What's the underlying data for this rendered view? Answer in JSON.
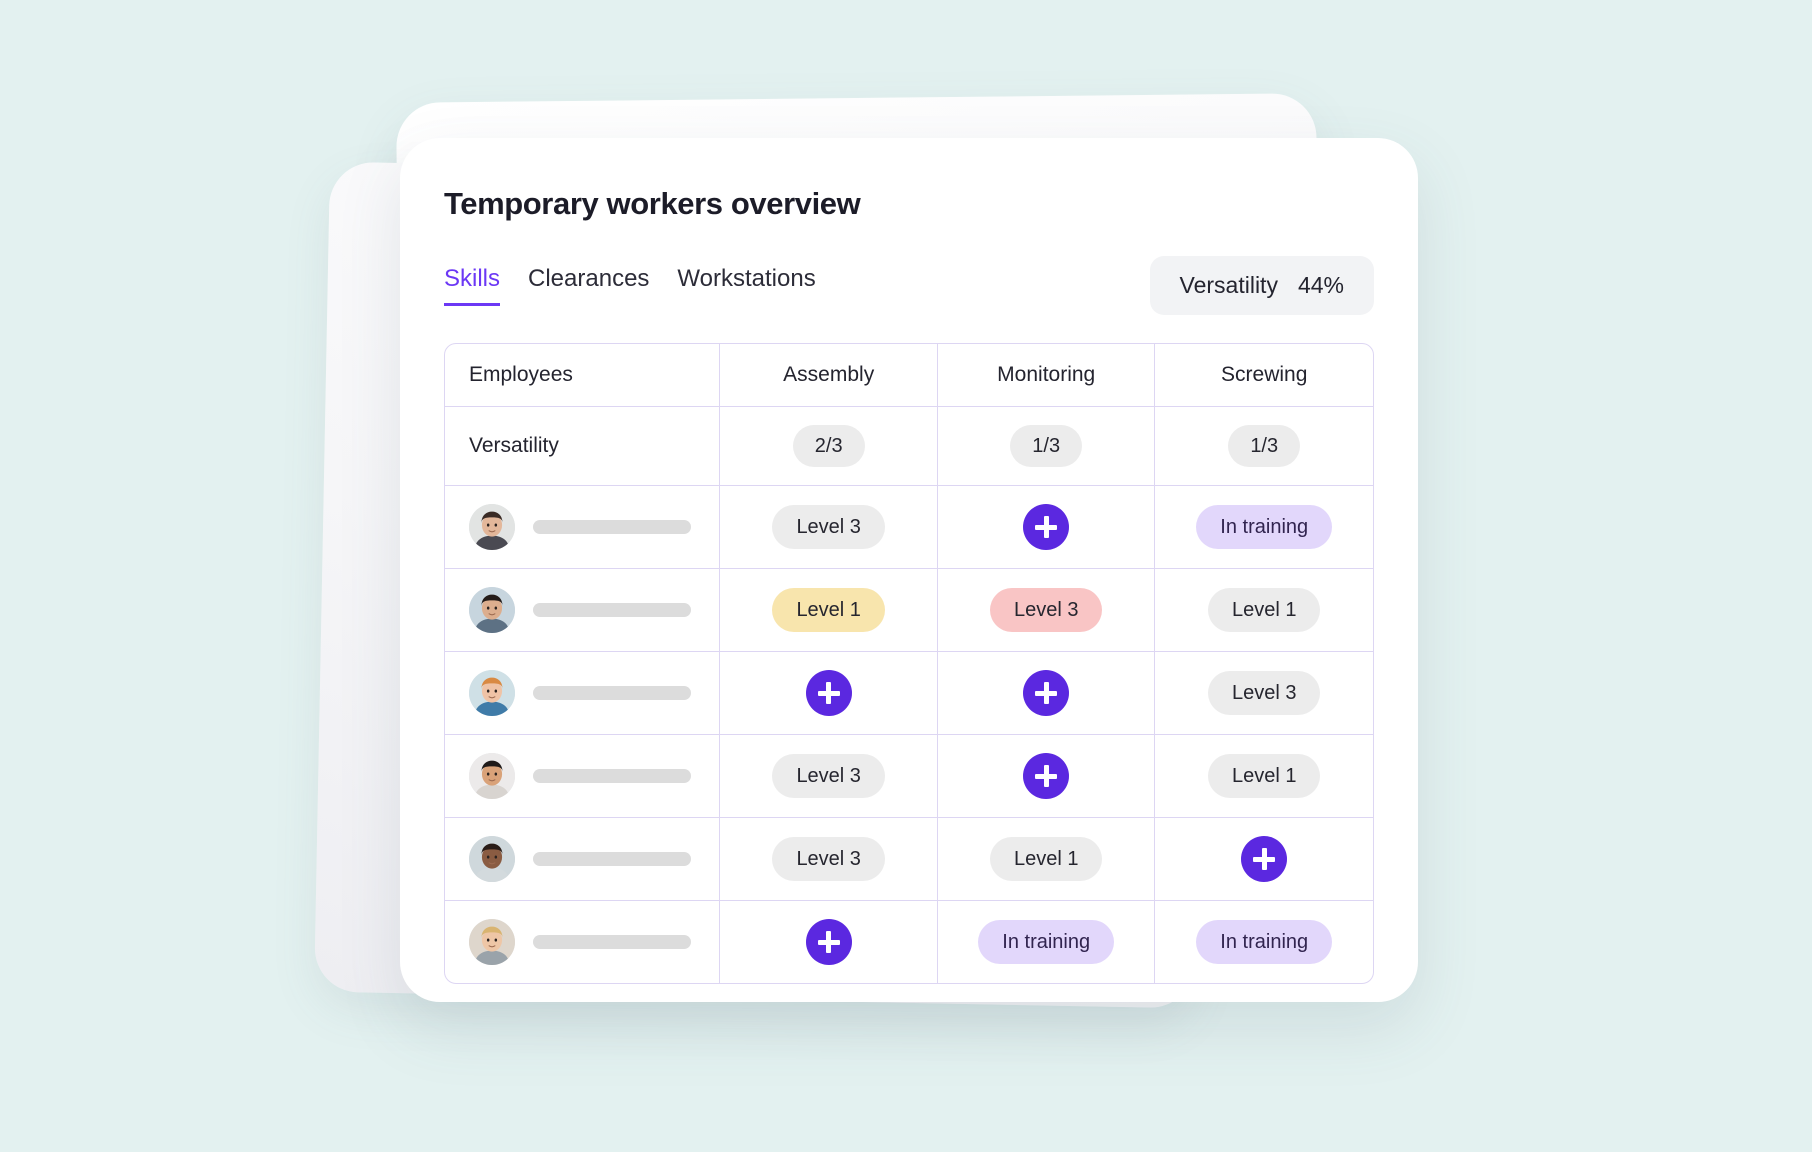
{
  "background_color": "#e3f1f0",
  "accent_color": "#6c38f5",
  "card": {
    "title": "Temporary workers overview"
  },
  "tabs": [
    {
      "label": "Skills",
      "active": true
    },
    {
      "label": "Clearances",
      "active": false
    },
    {
      "label": "Workstations",
      "active": false
    }
  ],
  "versatility_badge": {
    "label": "Versatility",
    "value": "44%"
  },
  "table": {
    "columns": [
      "Employees",
      "Assembly",
      "Monitoring",
      "Screwing"
    ],
    "versatility_row": {
      "label": "Versatility",
      "values": [
        "2/3",
        "1/3",
        "1/3"
      ]
    },
    "rows": [
      {
        "avatar": "avatar-person-1",
        "cells": [
          {
            "type": "pill",
            "label": "Level 3",
            "style": "gray"
          },
          {
            "type": "add-button",
            "label": "add-icon"
          },
          {
            "type": "pill",
            "label": "In training",
            "style": "lavender"
          }
        ]
      },
      {
        "avatar": "avatar-person-2",
        "cells": [
          {
            "type": "pill",
            "label": "Level 1",
            "style": "yellow"
          },
          {
            "type": "pill",
            "label": "Level 3",
            "style": "pink"
          },
          {
            "type": "pill",
            "label": "Level 1",
            "style": "gray"
          }
        ]
      },
      {
        "avatar": "avatar-person-3",
        "cells": [
          {
            "type": "add-button",
            "label": "add-icon"
          },
          {
            "type": "add-button",
            "label": "add-icon"
          },
          {
            "type": "pill",
            "label": "Level 3",
            "style": "gray"
          }
        ]
      },
      {
        "avatar": "avatar-person-4",
        "cells": [
          {
            "type": "pill",
            "label": "Level 3",
            "style": "gray"
          },
          {
            "type": "add-button",
            "label": "add-icon"
          },
          {
            "type": "pill",
            "label": "Level 1",
            "style": "gray"
          }
        ]
      },
      {
        "avatar": "avatar-person-5",
        "cells": [
          {
            "type": "pill",
            "label": "Level 3",
            "style": "gray"
          },
          {
            "type": "pill",
            "label": "Level 1",
            "style": "gray"
          },
          {
            "type": "add-button",
            "label": "add-icon"
          }
        ]
      },
      {
        "avatar": "avatar-person-6",
        "cells": [
          {
            "type": "add-button",
            "label": "add-icon"
          },
          {
            "type": "pill",
            "label": "In training",
            "style": "lavender"
          },
          {
            "type": "pill",
            "label": "In training",
            "style": "lavender"
          }
        ]
      }
    ]
  }
}
